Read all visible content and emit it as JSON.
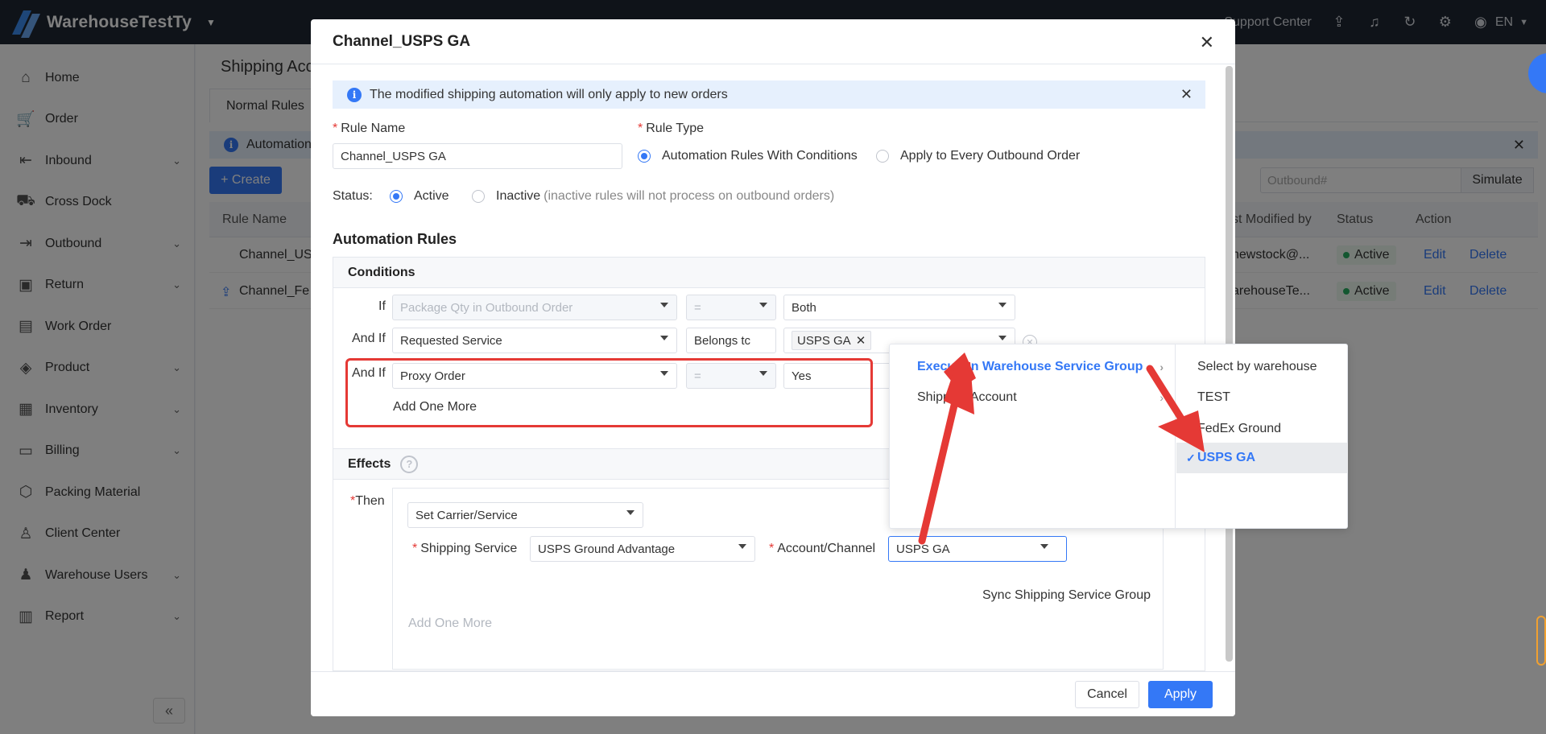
{
  "app": {
    "name": "WarehouseTestTy",
    "support": "Support Center",
    "language": "EN"
  },
  "sidebar": {
    "items": [
      {
        "label": "Home",
        "icon": "home-icon",
        "has_children": false
      },
      {
        "label": "Order",
        "icon": "cart-icon",
        "has_children": false
      },
      {
        "label": "Inbound",
        "icon": "inbound-truck-icon",
        "has_children": true
      },
      {
        "label": "Cross Dock",
        "icon": "truck-icon",
        "has_children": false
      },
      {
        "label": "Outbound",
        "icon": "outbound-truck-icon",
        "has_children": true
      },
      {
        "label": "Return",
        "icon": "return-box-icon",
        "has_children": true
      },
      {
        "label": "Work Order",
        "icon": "clipboard-icon",
        "has_children": false
      },
      {
        "label": "Product",
        "icon": "tag-icon",
        "has_children": true
      },
      {
        "label": "Inventory",
        "icon": "inventory-icon",
        "has_children": true
      },
      {
        "label": "Billing",
        "icon": "billing-icon",
        "has_children": true
      },
      {
        "label": "Packing Material",
        "icon": "package-icon",
        "has_children": false
      },
      {
        "label": "Client Center",
        "icon": "user-icon",
        "has_children": false
      },
      {
        "label": "Warehouse Users",
        "icon": "users-icon",
        "has_children": true
      },
      {
        "label": "Report",
        "icon": "report-icon",
        "has_children": true
      }
    ]
  },
  "background": {
    "page_title": "Shipping Acc",
    "tab": "Normal Rules",
    "notice": "Automation",
    "create": "+ Create",
    "search_placeholder": "Outbound#",
    "simulate": "Simulate",
    "columns": {
      "rule_name": "Rule Name",
      "modified_by": "st Modified by",
      "status": "Status",
      "action": "Action"
    },
    "rows": [
      {
        "name": "Channel_US",
        "modified_by": "newstock@...",
        "status": "Active",
        "edit": "Edit",
        "delete": "Delete"
      },
      {
        "name": "Channel_Fe",
        "modified_by": "arehouseTe...",
        "status": "Active",
        "edit": "Edit",
        "delete": "Delete"
      }
    ]
  },
  "modal": {
    "title": "Channel_USPS GA",
    "notice": "The modified shipping automation will only apply to new orders",
    "rule_name_label": "Rule Name",
    "rule_name_value": "Channel_USPS GA",
    "rule_type_label": "Rule Type",
    "rule_type_options": [
      "Automation Rules With Conditions",
      "Apply to Every Outbound Order"
    ],
    "status_label": "Status:",
    "status_active": "Active",
    "status_inactive": "Inactive",
    "status_inactive_hint": "(inactive rules will not process on outbound orders)",
    "automation_rules": "Automation Rules",
    "conditions_title": "Conditions",
    "conditions": [
      {
        "prefix": "If",
        "field": "Package Qty in Outbound Order",
        "op": "=",
        "value": "Both"
      },
      {
        "prefix": "And If",
        "field": "Requested Service",
        "op": "Belongs tc",
        "value": "USPS GA"
      },
      {
        "prefix": "And If",
        "field": "Proxy Order",
        "op": "=",
        "value": "Yes"
      }
    ],
    "add_one_more": "Add One More",
    "effects_title": "Effects",
    "then": "Then",
    "effect_action": "Set Carrier/Service",
    "shipping_service_label": "Shipping Service",
    "shipping_service_value": "USPS Ground Advantage",
    "account_label": "Account/Channel",
    "account_value": "USPS GA",
    "sync": "Sync Shipping Service Group",
    "add_one_more_effect": "Add One More",
    "cancel": "Cancel",
    "apply": "Apply"
  },
  "cascader": {
    "col1": [
      {
        "label": "Execution Warehouse Service Group",
        "active": true
      },
      {
        "label": "Shipping Account",
        "active": false
      }
    ],
    "col2": [
      {
        "label": "Select by warehouse",
        "selected": false
      },
      {
        "label": "TEST",
        "selected": false
      },
      {
        "label": "FedEx Ground",
        "selected": false
      },
      {
        "label": "USPS GA",
        "selected": true
      }
    ]
  },
  "colors": {
    "primary": "#3478f6",
    "annotation_red": "#e53935",
    "topbar": "#1f2633"
  }
}
